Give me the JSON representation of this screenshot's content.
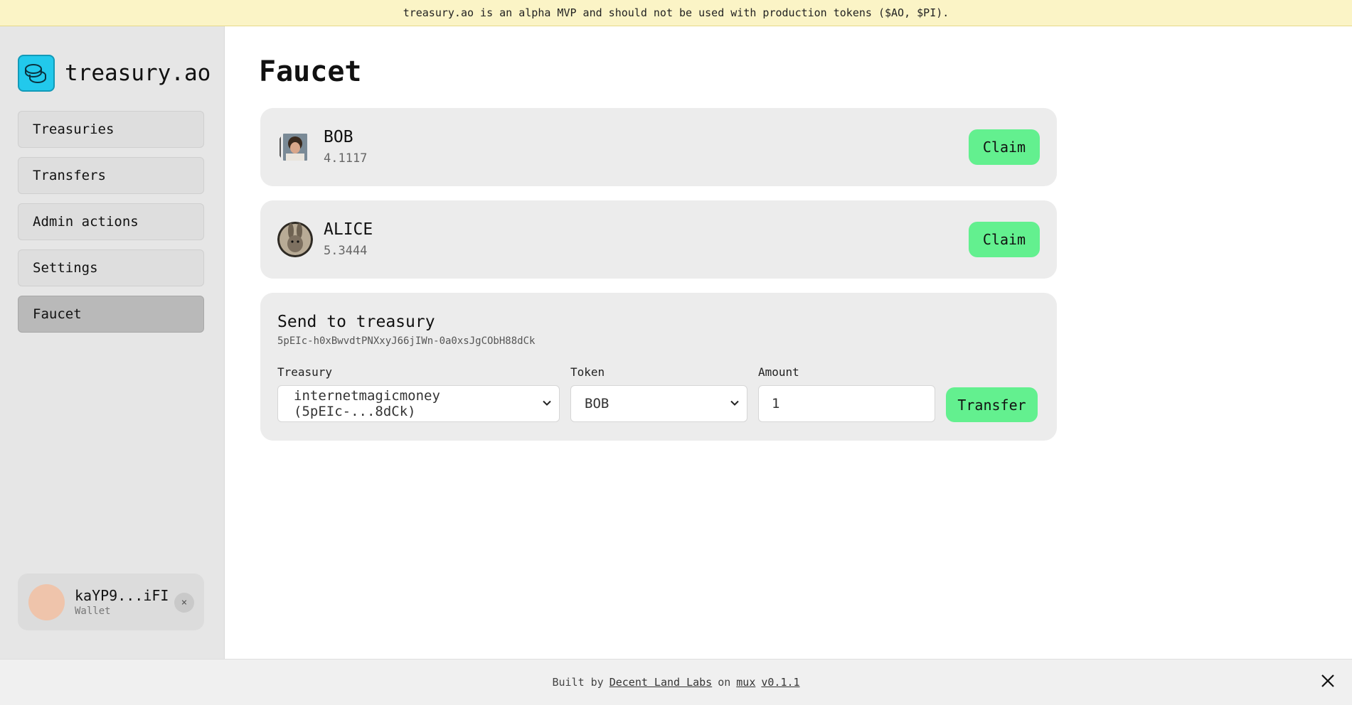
{
  "banner": {
    "text": "treasury.ao is an alpha MVP and should not be used with production tokens ($AO, $PI)."
  },
  "app": {
    "name": "treasury.ao"
  },
  "colors": {
    "accent_green": "#63f08f",
    "logo_cyan": "#22c9ec",
    "banner_bg": "#fbf4c6"
  },
  "sidebar": {
    "items": [
      {
        "label": "Treasuries",
        "active": false
      },
      {
        "label": "Transfers",
        "active": false
      },
      {
        "label": "Admin actions",
        "active": false
      },
      {
        "label": "Settings",
        "active": false
      },
      {
        "label": "Faucet",
        "active": true
      }
    ]
  },
  "wallet": {
    "address": "kaYP9...iFI",
    "label": "Wallet",
    "close": "×"
  },
  "main": {
    "title": "Faucet",
    "tokens": [
      {
        "name": "BOB",
        "balance": "4.1117",
        "claim_label": "Claim"
      },
      {
        "name": "ALICE",
        "balance": "5.3444",
        "claim_label": "Claim"
      }
    ],
    "send": {
      "title": "Send to treasury",
      "address": "5pEIc-h0xBwvdtPNXxyJ66jIWn-0a0xsJgCObH88dCk",
      "treasury_label": "Treasury",
      "treasury_value": "internetmagicmoney (5pEIc-...8dCk)",
      "token_label": "Token",
      "token_value": "BOB",
      "amount_label": "Amount",
      "amount_value": "1",
      "transfer_label": "Transfer"
    }
  },
  "footer": {
    "built_by": "Built by",
    "org": "Decent Land Labs",
    "on": "on",
    "mux": "mux",
    "version": "v0.1.1"
  }
}
